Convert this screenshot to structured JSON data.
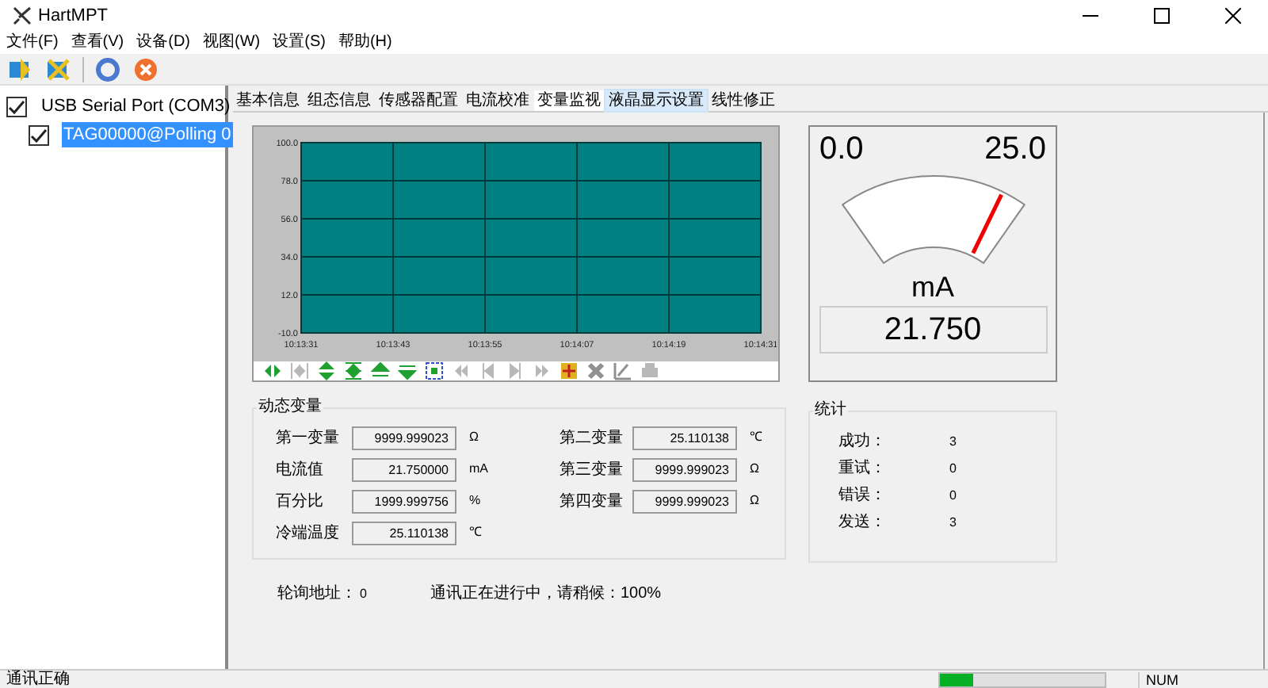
{
  "window": {
    "title": "HartMPT"
  },
  "menu": [
    "文件(F)",
    "查看(V)",
    "设备(D)",
    "视图(W)",
    "设置(S)",
    "帮助(H)"
  ],
  "toolbar": [
    {
      "kind": "connect"
    },
    {
      "kind": "disconnect"
    },
    {
      "kind": "refresh"
    },
    {
      "kind": "stop"
    }
  ],
  "tree": [
    {
      "label": "USB Serial Port (COM3)",
      "checked": true,
      "selected": false,
      "children": [
        {
          "label": "TAG00000@Polling 0",
          "checked": true,
          "selected": true
        }
      ]
    }
  ],
  "tabs": [
    {
      "label": "基本信息",
      "selected": false,
      "hovered": false
    },
    {
      "label": "组态信息",
      "selected": false,
      "hovered": false
    },
    {
      "label": "传感器配置",
      "selected": false,
      "hovered": false
    },
    {
      "label": "电流校准",
      "selected": false,
      "hovered": false
    },
    {
      "label": "变量监视",
      "selected": true,
      "hovered": false
    },
    {
      "label": "液晶显示设置",
      "selected": false,
      "hovered": true
    },
    {
      "label": "线性修正",
      "selected": false,
      "hovered": false
    }
  ],
  "chart": {
    "chart_data": {
      "type": "line",
      "grid": true,
      "ylim": [
        -10,
        100
      ],
      "yticks": [
        {
          "value": -10,
          "label": "-10.0"
        },
        {
          "value": 12,
          "label": "12.0"
        },
        {
          "value": 34,
          "label": "34.0"
        },
        {
          "value": 56,
          "label": "56.0"
        },
        {
          "value": 78,
          "label": "78.0"
        },
        {
          "value": 100,
          "label": "100.0"
        }
      ],
      "categories": [
        "10:13:31",
        "10:13:43",
        "10:13:55",
        "10:14:07",
        "10:14:19",
        "10:14:31"
      ]
    },
    "tools": [
      {
        "kind": "pan-x",
        "disabled": false
      },
      {
        "kind": "fit-x",
        "disabled": true
      },
      {
        "kind": "pan-y",
        "disabled": false
      },
      {
        "kind": "fit-y",
        "disabled": false
      },
      {
        "kind": "up",
        "disabled": false
      },
      {
        "kind": "down",
        "disabled": false
      },
      {
        "kind": "zoom-box",
        "disabled": false
      },
      {
        "kind": "first",
        "disabled": true
      },
      {
        "kind": "prev",
        "disabled": true
      },
      {
        "kind": "next",
        "disabled": true
      },
      {
        "kind": "last",
        "disabled": true
      },
      {
        "kind": "cursor",
        "disabled": false
      },
      {
        "kind": "tools",
        "disabled": true
      },
      {
        "kind": "edit",
        "disabled": true
      },
      {
        "kind": "print",
        "disabled": true
      }
    ]
  },
  "gauge": {
    "min_label": "0.0",
    "max_label": "25.0",
    "level": 0.87,
    "unit": "mA",
    "reading": "21.750"
  },
  "dynamic_vars": {
    "title": "动态变量",
    "left": [
      {
        "label": "第一变量",
        "value": "9999.999023",
        "unit": "Ω"
      },
      {
        "label": "电流值",
        "value": "21.750000",
        "unit": "mA"
      },
      {
        "label": "百分比",
        "value": "1999.999756",
        "unit": "%"
      },
      {
        "label": "冷端温度",
        "value": "25.110138",
        "unit": "℃"
      }
    ],
    "right": [
      {
        "label": "第二变量",
        "value": "25.110138",
        "unit": "℃"
      },
      {
        "label": "第三变量",
        "value": "9999.999023",
        "unit": "Ω"
      },
      {
        "label": "第四变量",
        "value": "9999.999023",
        "unit": "Ω"
      }
    ]
  },
  "stats": {
    "title": "统计",
    "rows": [
      {
        "label": "成功：",
        "value": "3"
      },
      {
        "label": "重试：",
        "value": "0"
      },
      {
        "label": "错误：",
        "value": "0"
      },
      {
        "label": "发送：",
        "value": "3"
      }
    ]
  },
  "footer": {
    "poll_label": "轮询地址：",
    "poll_value": "0",
    "progress_text": "通讯正在进行中，请稍候：100%"
  },
  "status_bar": {
    "message": "通讯正确",
    "level": 0.2,
    "indicator": "NUM"
  }
}
